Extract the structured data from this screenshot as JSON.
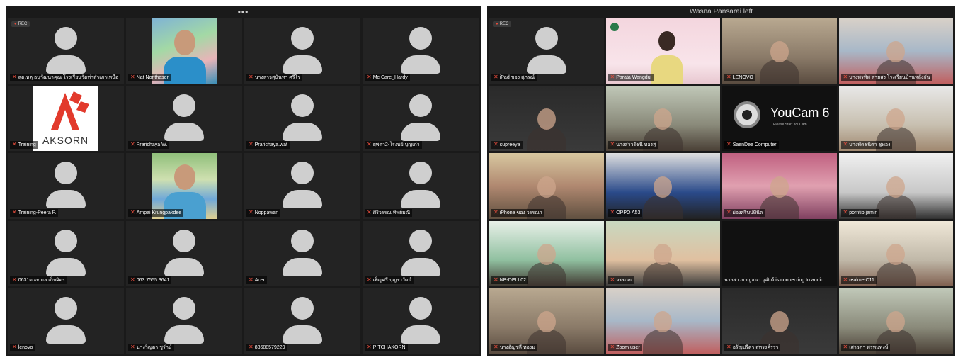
{
  "left": {
    "topbar": "•••",
    "rec": "REC",
    "tiles": [
      {
        "name": "สุดเหตุ อนุวัฒนาคุณ โรงเรียนวัดท่าสำเภาเหนือ",
        "type": "avatar"
      },
      {
        "name": "Nat Nonthasen",
        "type": "photo"
      },
      {
        "name": "นางสาวสุนันทา ศรีโร",
        "type": "avatar"
      },
      {
        "name": "Mc Care_Hardy",
        "type": "avatar"
      },
      {
        "name": "Training",
        "type": "logo",
        "logo_text": "AKSORN"
      },
      {
        "name": "Prarichaya W.",
        "type": "avatar"
      },
      {
        "name": "Prarichaya.wat",
        "type": "avatar"
      },
      {
        "name": "ยุพดา2-โรงพย์ บุญเก่า",
        "type": "avatar"
      },
      {
        "name": "Training-Peera P.",
        "type": "avatar"
      },
      {
        "name": "Ampai Krungpakdee",
        "type": "photo"
      },
      {
        "name": "Noppawan",
        "type": "avatar"
      },
      {
        "name": "ศิริวรรณ ทิพย์มณี",
        "type": "avatar"
      },
      {
        "name": "0631ดวงกมล เก็บผิตร",
        "type": "avatar"
      },
      {
        "name": "063 7555 3641",
        "type": "avatar"
      },
      {
        "name": "Acer",
        "type": "avatar"
      },
      {
        "name": "เพ็ญศรี บุญราวัตน์",
        "type": "avatar"
      },
      {
        "name": "lenovo",
        "type": "avatar"
      },
      {
        "name": "นางวิญตา ชูรักษ์",
        "type": "avatar"
      },
      {
        "name": "83688579229",
        "type": "avatar"
      },
      {
        "name": "PITCHAKORN",
        "type": "avatar"
      }
    ]
  },
  "right": {
    "topbar": "Wasna Pansarai left",
    "rec": "REC",
    "tiles": [
      {
        "name": "iPad ของ สุภรณ์",
        "type": "avatar"
      },
      {
        "name": "Parata Wangdul",
        "type": "slide"
      },
      {
        "name": "LENOVO",
        "type": "video"
      },
      {
        "name": "นางพรทิพ สายสง โรงเรียนบ้านหลังกัน",
        "type": "video"
      },
      {
        "name": "supreeya",
        "type": "video"
      },
      {
        "name": "นางสาวรัชนี ทองสุ",
        "type": "video"
      },
      {
        "name": "SaenDee Computer",
        "type": "youcam",
        "youcam_title": "YouCam 6",
        "youcam_sub": "Please Start YouCam"
      },
      {
        "name": "นางพัดชนิตา ชูทอง",
        "type": "video"
      },
      {
        "name": "iPhone ของ วรรณา",
        "type": "video"
      },
      {
        "name": "OPPO A53",
        "type": "video"
      },
      {
        "name": "ผ่องศรีบปทีนิด",
        "type": "video"
      },
      {
        "name": "porntip jamin",
        "type": "video"
      },
      {
        "name": "NB-DELL02",
        "type": "video"
      },
      {
        "name": "จรรณน",
        "type": "video"
      },
      {
        "name": "นางสาวกาญจนา วุฒิเต้ is connecting to audio",
        "type": "connecting"
      },
      {
        "name": "realme C11",
        "type": "video"
      },
      {
        "name": "นางอัญชลี ทองม",
        "type": "video"
      },
      {
        "name": "Zoom user",
        "type": "video"
      },
      {
        "name": "อรัญปรีดา สุทรงค์รรา",
        "type": "video"
      },
      {
        "name": "เสาวภา พรหมพงษ์",
        "type": "video"
      }
    ]
  }
}
